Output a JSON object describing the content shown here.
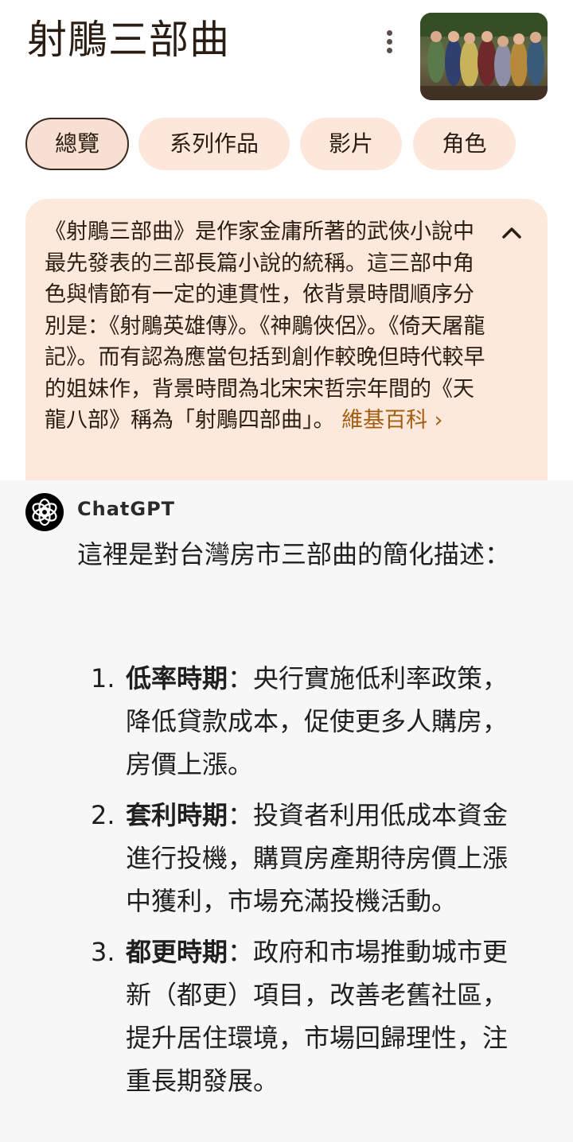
{
  "knowledge_panel": {
    "title": "射鵰三部曲",
    "more_icon": "more-vert-icon",
    "tabs": [
      {
        "label": "總覽",
        "active": true
      },
      {
        "label": "系列作品",
        "active": false
      },
      {
        "label": "影片",
        "active": false
      },
      {
        "label": "角色",
        "active": false
      }
    ],
    "summary": "《射鵰三部曲》是作家金庸所著的武俠小說中最先發表的三部長篇小說的統稱。這三部中角色與情節有一定的連貫性，依背景時間順序分別是：《射鵰英雄傳》。《神鵰俠侶》。《倚天屠龍記》。而有認為應當包括到創作較晚但時代較早的姐妹作，背景時間為北宋宋哲宗年間的《天龍八部》稱為「射鵰四部曲」。",
    "source_link": "維基百科 ›",
    "collapse_icon": "chevron-up-icon",
    "accent_color": "#a45e12",
    "card_bg": "#fde9dc"
  },
  "chat": {
    "author": "ChatGPT",
    "logo_icon": "openai-logo-icon",
    "intro": "這裡是對台灣房市三部曲的簡化描述：",
    "items": [
      {
        "num": "1.",
        "term": "低率時期",
        "desc": "：央行實施低利率政策，降低貸款成本，促使更多人購房，房價上漲。"
      },
      {
        "num": "2.",
        "term": "套利時期",
        "desc": "：投資者利用低成本資金進行投機，購買房產期待房價上漲中獲利，市場充滿投機活動。"
      },
      {
        "num": "3.",
        "term": "都更時期",
        "desc": "：政府和市場推動城市更新（都更）項目，改善老舊社區，提升居住環境，市場回歸理性，注重長期發展。"
      }
    ]
  }
}
